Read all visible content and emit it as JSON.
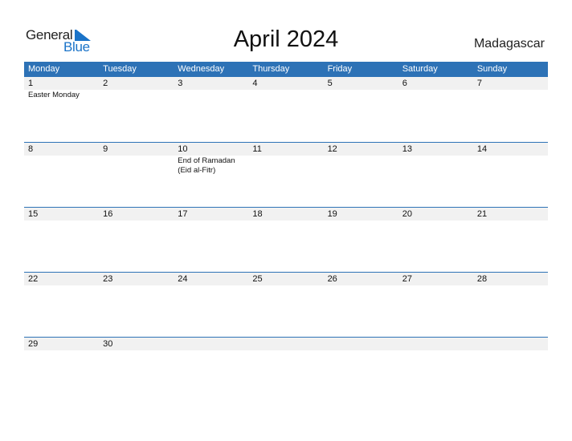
{
  "logo": {
    "word1": "General",
    "word2": "Blue"
  },
  "title": "April 2024",
  "country": "Madagascar",
  "colors": {
    "accent": "#2d72b6",
    "band": "#f1f1f1"
  },
  "weekdays": [
    "Monday",
    "Tuesday",
    "Wednesday",
    "Thursday",
    "Friday",
    "Saturday",
    "Sunday"
  ],
  "weeks": [
    [
      {
        "day": "1",
        "holiday": "Easter Monday"
      },
      {
        "day": "2"
      },
      {
        "day": "3"
      },
      {
        "day": "4"
      },
      {
        "day": "5"
      },
      {
        "day": "6"
      },
      {
        "day": "7"
      }
    ],
    [
      {
        "day": "8"
      },
      {
        "day": "9"
      },
      {
        "day": "10",
        "holiday": "End of Ramadan (Eid al-Fitr)"
      },
      {
        "day": "11"
      },
      {
        "day": "12"
      },
      {
        "day": "13"
      },
      {
        "day": "14"
      }
    ],
    [
      {
        "day": "15"
      },
      {
        "day": "16"
      },
      {
        "day": "17"
      },
      {
        "day": "18"
      },
      {
        "day": "19"
      },
      {
        "day": "20"
      },
      {
        "day": "21"
      }
    ],
    [
      {
        "day": "22"
      },
      {
        "day": "23"
      },
      {
        "day": "24"
      },
      {
        "day": "25"
      },
      {
        "day": "26"
      },
      {
        "day": "27"
      },
      {
        "day": "28"
      }
    ],
    [
      {
        "day": "29"
      },
      {
        "day": "30"
      },
      {
        "day": ""
      },
      {
        "day": ""
      },
      {
        "day": ""
      },
      {
        "day": ""
      },
      {
        "day": ""
      }
    ]
  ]
}
